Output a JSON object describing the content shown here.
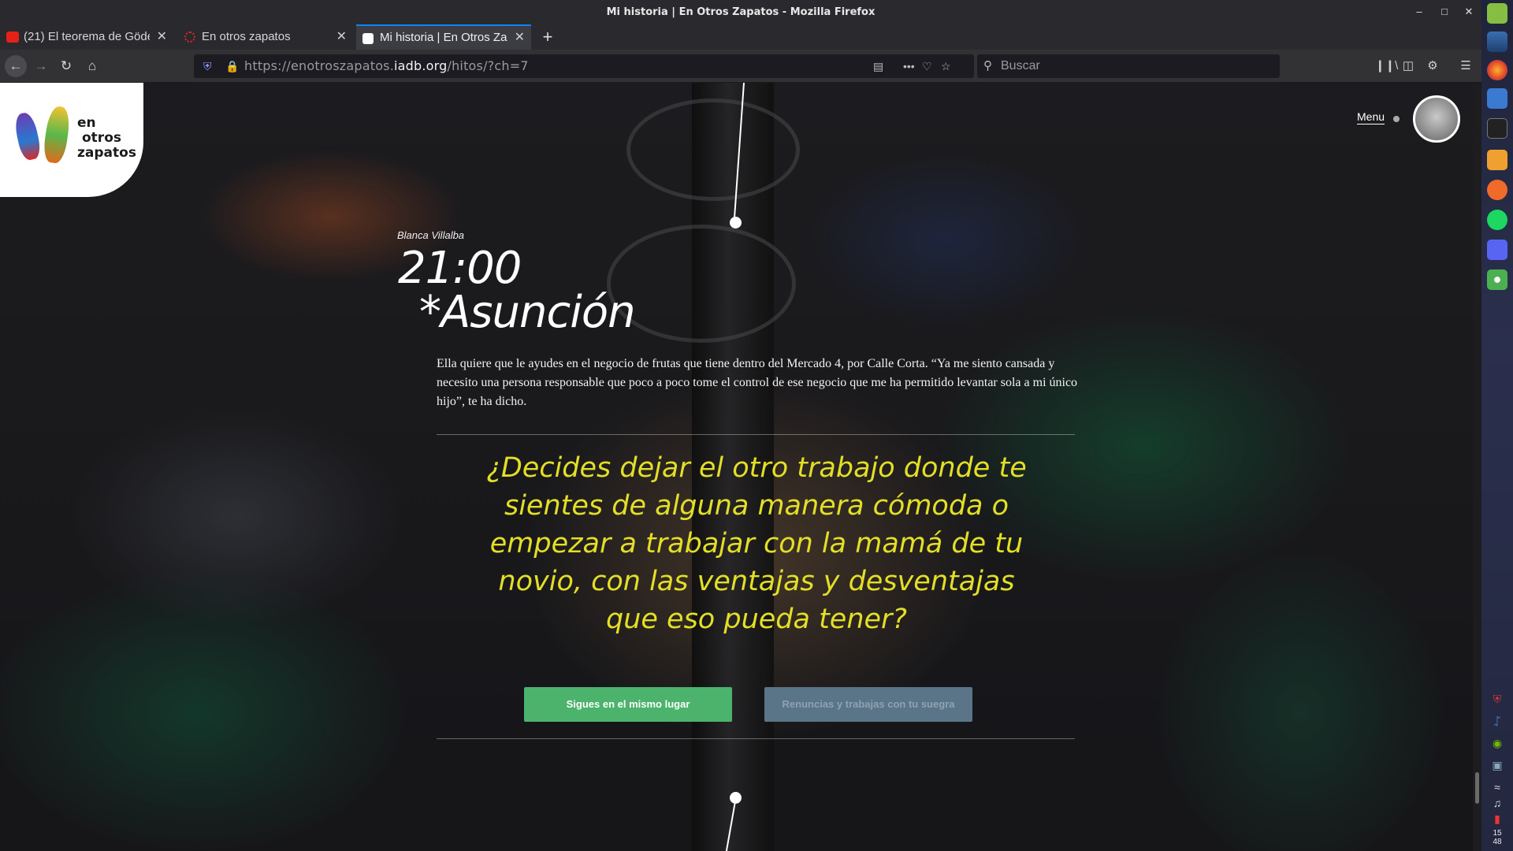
{
  "window": {
    "title": "Mi historia | En Otros Zapatos - Mozilla Firefox"
  },
  "tabs": [
    {
      "label": "(21) El teorema de Gödel",
      "favicon_color": "#e62117"
    },
    {
      "label": "En otros zapatos",
      "favicon_color": "#d7262a"
    },
    {
      "label": "Mi historia | En Otros Zapatos",
      "favicon_color": "#ffffff"
    }
  ],
  "navbar": {
    "url_scheme": "https://",
    "url_host_pre": "enotroszapatos.",
    "url_host_main": "iadb.org",
    "url_path": "/hitos/?ch=7",
    "search_placeholder": "Buscar"
  },
  "page": {
    "logo_text": [
      "en",
      "otros",
      "zapatos"
    ],
    "menu_label": "Menu",
    "author": "Blanca Villalba",
    "time": "21:00",
    "place": "*Asunción",
    "story": "Ella quiere que le ayudes en el negocio de frutas que tiene dentro del Mercado 4, por Calle Corta. “Ya me siento cansada y necesito una persona responsable que poco a poco tome el control de ese negocio que me ha permitido levantar sola a mi único hijo”, te ha dicho.",
    "question": "¿Decides dejar el otro trabajo donde te sientes de alguna manera cómoda o empezar a trabajar con la mamá de tu novio, con las ventajas y desventajas que eso pueda tener?",
    "options": [
      {
        "label": "Sigues en el mismo lugar",
        "color": "#4bb36b"
      },
      {
        "label": "Renuncias y trabajas con tu suegra",
        "color": "#5a7488"
      }
    ],
    "accent_color": "#e3df27"
  },
  "system_panel": {
    "clock_hour": "15",
    "clock_minute": "48"
  }
}
